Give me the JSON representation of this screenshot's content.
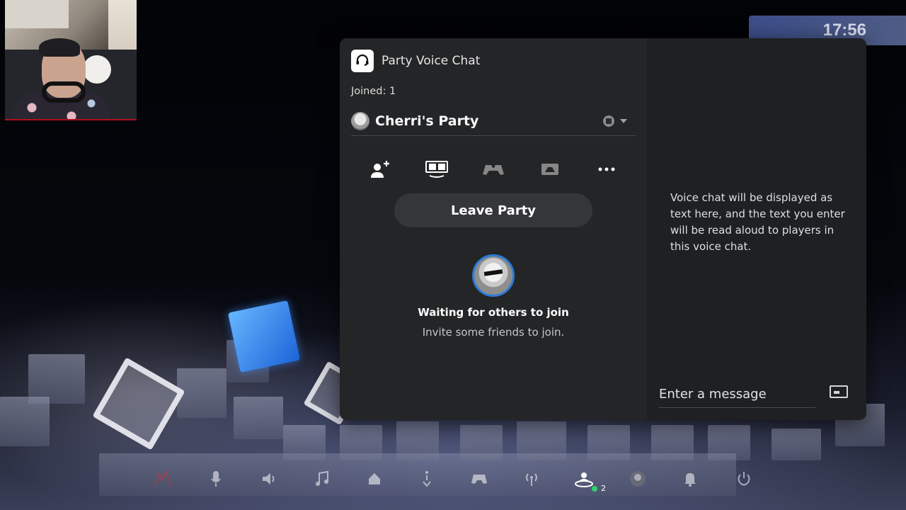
{
  "clock": {
    "time": "17:56"
  },
  "webcam": {
    "label": "webcam-overlay"
  },
  "party_panel": {
    "app_title": "Party Voice Chat",
    "joined_text": "Joined: 1",
    "party_name": "Cherri's Party",
    "actions": [
      {
        "name": "invite-icon"
      },
      {
        "name": "share-screen-icon"
      },
      {
        "name": "share-play-icon"
      },
      {
        "name": "game-icon"
      },
      {
        "name": "more-icon"
      }
    ],
    "leave_button": "Leave Party",
    "waiting_title": "Waiting for others to join",
    "waiting_sub": "Invite some friends to join.",
    "chat_info": "Voice chat will be displayed as text here, and the text you enter will be read aloud to players in this voice chat.",
    "message_placeholder": "Enter a message"
  },
  "control_center": {
    "items": [
      "mic-icon",
      "sound-icon",
      "music-icon",
      "home-icon",
      "accessibility-icon",
      "controller-icon",
      "network-icon",
      "party-icon",
      "profile-icon",
      "notifications-icon",
      "power-icon"
    ],
    "party_count": "2"
  },
  "colors": {
    "accent": "#2d7bd6",
    "online": "#2bd46c",
    "panel": "#232426"
  }
}
